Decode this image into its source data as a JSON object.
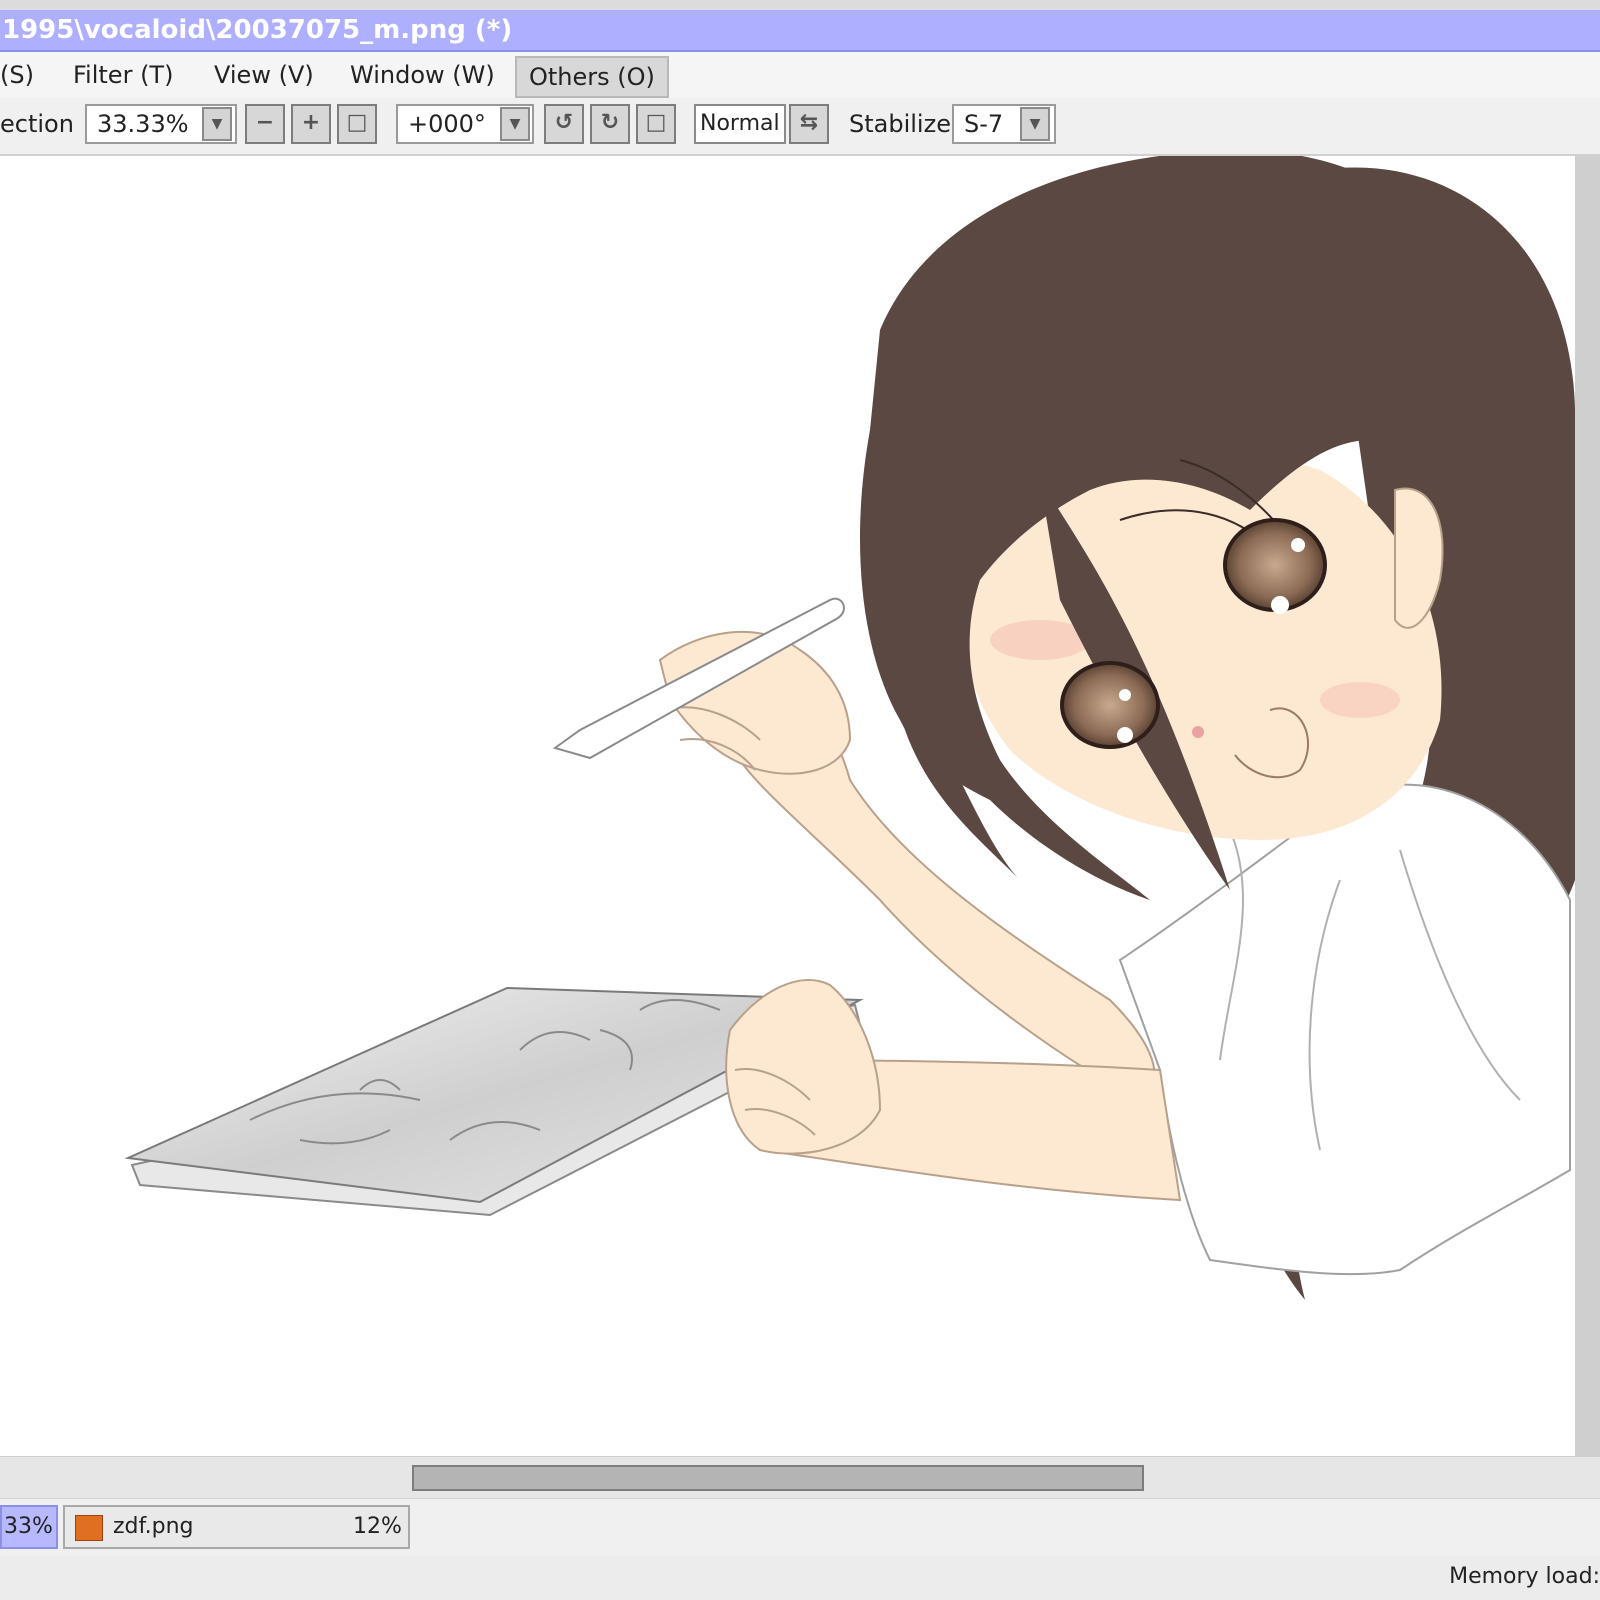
{
  "window": {
    "title": "1995\\vocaloid\\20037075_m.png (*)"
  },
  "menu": {
    "items": [
      {
        "label": "(S)"
      },
      {
        "label": "Filter (T)"
      },
      {
        "label": "View (V)"
      },
      {
        "label": "Window (W)"
      },
      {
        "label": "Others (O)"
      }
    ]
  },
  "toolbar": {
    "selection_label": "ection",
    "zoom_value": "33.33%",
    "rotation_value": "+000°",
    "mode_label": "Normal",
    "stabilizer_label": "Stabilizer",
    "stabilizer_value": "S-7"
  },
  "tabs": [
    {
      "percent": "33%"
    },
    {
      "name": "zdf.png",
      "percent": "12%"
    }
  ],
  "status": {
    "memory_label": "Memory load:"
  },
  "colors": {
    "title_bar": "#aeb0ff",
    "active_tab": "#b7b8ff",
    "hair": "#5c4842",
    "skin": "#fde8d2",
    "eye": "#8b6b55"
  }
}
